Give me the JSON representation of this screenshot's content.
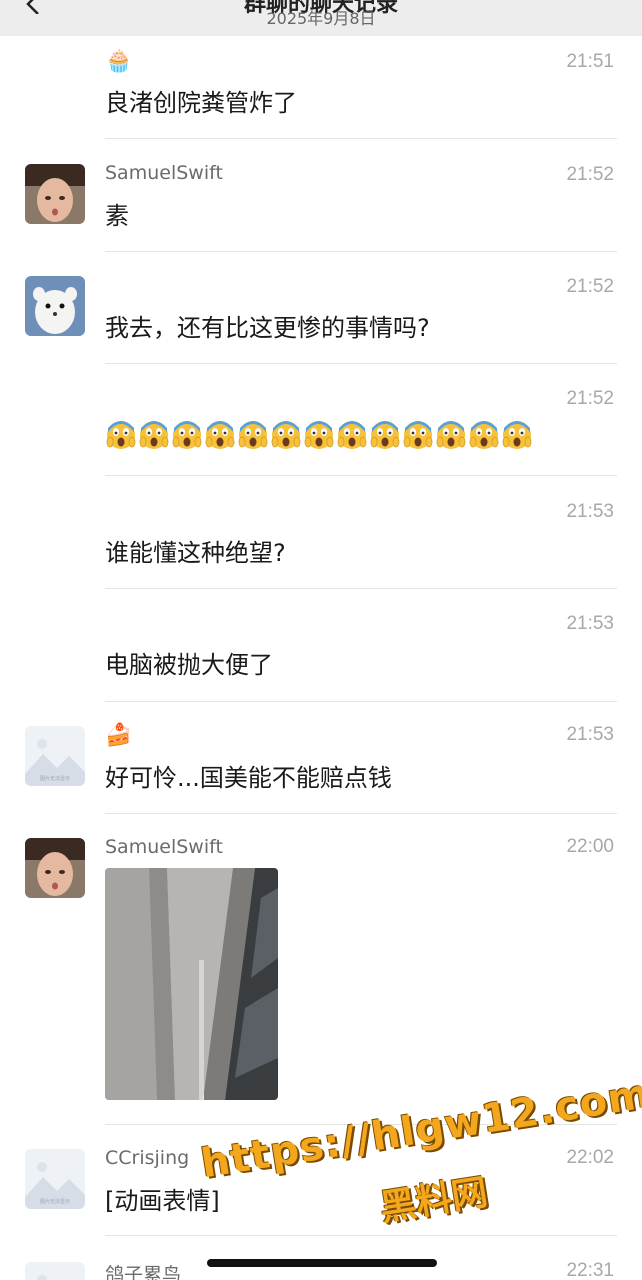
{
  "header": {
    "title": "群聊的聊天记录",
    "date": "2025年9月8日"
  },
  "messages": [
    {
      "sender": "",
      "sender_emoji": "🧁",
      "time": "21:51",
      "text": "良渚创院粪管炸了"
    },
    {
      "sender": "SamuelSwift",
      "time": "21:52",
      "text": "素"
    },
    {
      "sender": "",
      "time": "21:52",
      "text": "我去，还有比这更惨的事情吗?"
    },
    {
      "sender": "",
      "time": "21:52",
      "emoji_count": 13,
      "emoji": "scream"
    },
    {
      "sender": "",
      "time": "21:53",
      "text": "谁能懂这种绝望?"
    },
    {
      "sender": "",
      "time": "21:53",
      "text": "电脑被抛大便了"
    },
    {
      "sender": "",
      "sender_emoji": "🍰",
      "time": "21:53",
      "text": "好可怜...国美能不能赔点钱"
    },
    {
      "sender": "SamuelSwift",
      "time": "22:00",
      "image": "ceiling-photo"
    },
    {
      "sender": "CCrisjing",
      "time": "22:02",
      "text": "[动画表情]"
    },
    {
      "sender": "鸽子累鸟",
      "time": "22:31"
    }
  ],
  "watermark": {
    "url": "https://hlgw12.com",
    "name": "黑料网"
  },
  "colors": {
    "header_bg": "#ededed",
    "time": "#a8a8a8",
    "sender": "#6b6b6b",
    "watermark": "#f3a71c"
  }
}
